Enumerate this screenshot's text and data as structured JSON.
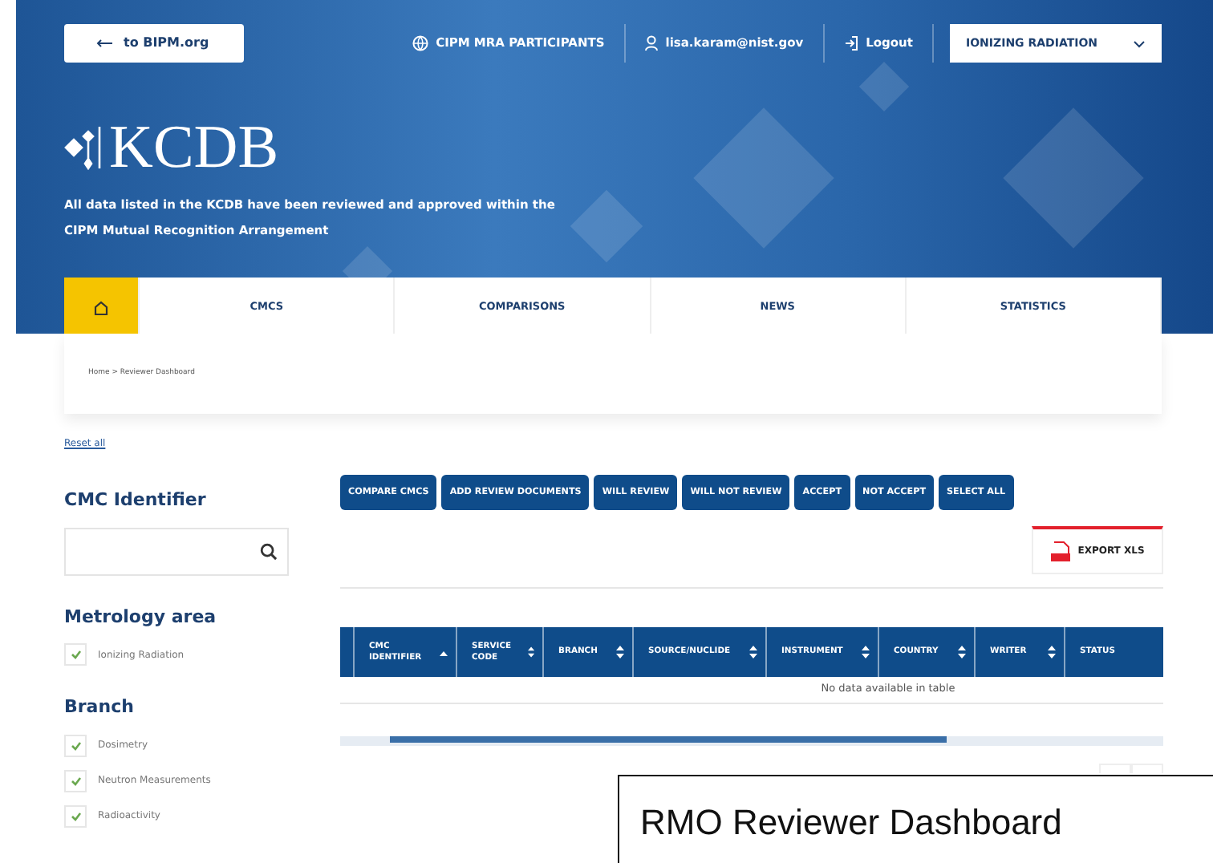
{
  "top_bar": {
    "back_link": "to BIPM.org",
    "participants": "CIPM MRA PARTICIPANTS",
    "user": "lisa.karam@nist.gov",
    "logout": "Logout",
    "area_select": "IONIZING RADIATION"
  },
  "hero": {
    "logo": "KCDB",
    "tagline": "All data listed in the KCDB have been reviewed and approved within the CIPM Mutual Recognition Arrangement"
  },
  "nav": [
    {
      "kind": "home",
      "selected": true
    },
    {
      "kind": "text",
      "label": "CMCS",
      "selected": false
    },
    {
      "kind": "text",
      "label": "COMPARISONS",
      "selected": false
    },
    {
      "kind": "text",
      "label": "NEWS",
      "selected": false
    },
    {
      "kind": "text",
      "label": "STATISTICS",
      "selected": false
    }
  ],
  "breadcrumb": "Home > Reviewer Dashboard",
  "sidebar": {
    "reset": "Reset all",
    "identifier_heading": "CMC Identifier",
    "groups": [
      {
        "heading": "Metrology area",
        "items": [
          {
            "label": "Ionizing Radiation",
            "checked": true
          }
        ]
      },
      {
        "heading": "Branch",
        "items": [
          {
            "label": "Dosimetry",
            "checked": true
          },
          {
            "label": "Neutron Measurements",
            "checked": true
          },
          {
            "label": "Radioactivity",
            "checked": true
          }
        ]
      }
    ]
  },
  "actions": [
    "COMPARE CMCS",
    "ADD REVIEW DOCUMENTS",
    "WILL REVIEW",
    "WILL NOT REVIEW",
    "ACCEPT",
    "NOT ACCEPT",
    "SELECT ALL"
  ],
  "export": "EXPORT XLS",
  "table": {
    "columns": [
      {
        "label": "CMC IDENTIFIER",
        "sorted": true
      },
      {
        "label": "SERVICE CODE",
        "sortable": true,
        "sorted": false
      },
      {
        "label": "BRANCH",
        "sortable": true,
        "sorted": false
      },
      {
        "label": "SOURCE/NUCLIDE",
        "sortable": true,
        "sorted": false
      },
      {
        "label": "INSTRUMENT",
        "sortable": true,
        "sorted": false
      },
      {
        "label": "COUNTRY",
        "sortable": true,
        "sorted": false
      },
      {
        "label": "WRITER",
        "sortable": true,
        "sorted": false
      },
      {
        "label": "STATUS",
        "sortable": false,
        "sorted": false
      }
    ],
    "empty": "No data available in table"
  },
  "caption": "RMO Reviewer Dashboard"
}
